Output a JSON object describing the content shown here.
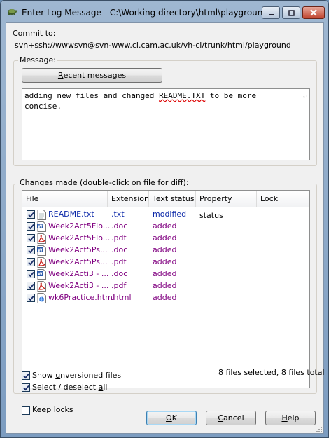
{
  "window": {
    "title": "Enter Log Message - C:\\Working directory\\html\\playground"
  },
  "commit": {
    "label": "Commit to:",
    "url": "svn+ssh://wwwsvn@svn-www.cl.cam.ac.uk/vh-cl/trunk/html/playground"
  },
  "message": {
    "group_label": "Message:",
    "recent_button_pre": "",
    "recent_button_ul": "R",
    "recent_button_post": "ecent messages",
    "text_line1_pre": "adding new files and changed ",
    "text_line1_spell": "README.TXT",
    "text_line1_post": " to be more",
    "text_line2": "concise."
  },
  "changes": {
    "group_label": "Changes made (double-click on file for diff):",
    "columns": [
      "File",
      "Extension",
      "Text status",
      "Property status",
      "Lock"
    ],
    "rows": [
      {
        "file": "README.txt",
        "ext": ".txt",
        "status": "modified",
        "icon": "text-file-icon"
      },
      {
        "file": "Week2Act5Flo...",
        "ext": ".doc",
        "status": "added",
        "icon": "word-doc-icon"
      },
      {
        "file": "Week2Act5Flo...",
        "ext": ".pdf",
        "status": "added",
        "icon": "pdf-icon"
      },
      {
        "file": "Week2Act5Ps...",
        "ext": ".doc",
        "status": "added",
        "icon": "word-doc-icon"
      },
      {
        "file": "Week2Act5Ps...",
        "ext": ".pdf",
        "status": "added",
        "icon": "pdf-icon"
      },
      {
        "file": "Week2Acti3 - ...",
        "ext": ".doc",
        "status": "added",
        "icon": "word-doc-icon"
      },
      {
        "file": "Week2Acti3 - ...",
        "ext": ".pdf",
        "status": "added",
        "icon": "pdf-icon"
      },
      {
        "file": "wk6Practice.html",
        "ext": ".html",
        "status": "added",
        "icon": "html-file-icon"
      }
    ],
    "summary": "8 files selected, 8 files total"
  },
  "options": {
    "show_unversioned_pre": "Show ",
    "show_unversioned_ul": "u",
    "show_unversioned_post": "nversioned files",
    "select_all_pre": "Select / deselect ",
    "select_all_ul": "a",
    "select_all_post": "ll",
    "keep_locks_pre": "Keep ",
    "keep_locks_ul": "l",
    "keep_locks_post": "ocks"
  },
  "buttons": {
    "ok_ul": "O",
    "ok_post": "K",
    "cancel_pre": "",
    "cancel_ul": "C",
    "cancel_post": "ancel",
    "help_ul": "H",
    "help_post": "elp"
  },
  "colors": {
    "added": "#800080",
    "modified": "#0a27a8"
  }
}
